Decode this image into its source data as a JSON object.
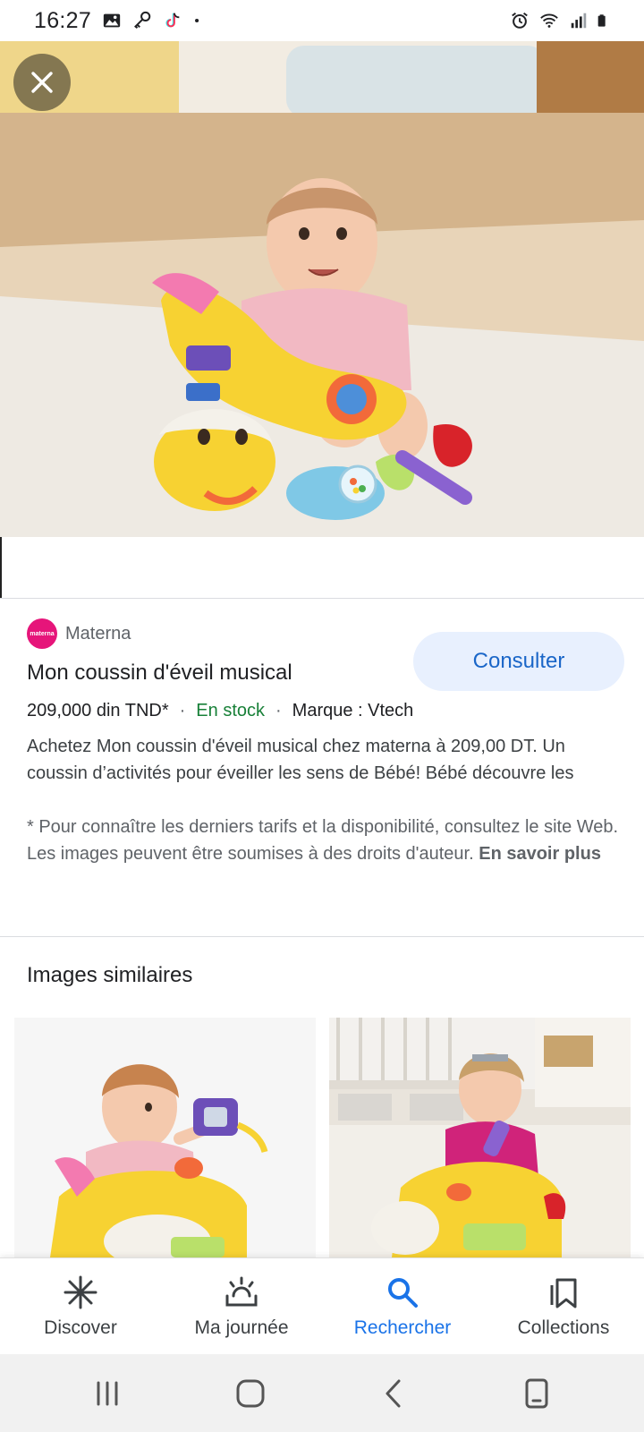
{
  "status_bar": {
    "time": "16:27",
    "left_icons": [
      "gallery-icon",
      "key-icon",
      "tiktok-icon",
      "dot-icon"
    ],
    "right_icons": [
      "alarm-icon",
      "wifi-icon",
      "signal-icon",
      "battery-icon"
    ]
  },
  "hero": {
    "close_icon": "close-icon"
  },
  "product": {
    "source_logo_text": "materna",
    "source_name": "Materna",
    "title": "Mon coussin d'éveil musical",
    "price": "209,000 din TND*",
    "separator": "·",
    "stock": "En stock",
    "brand": "Marque : Vtech",
    "consult_label": "Consulter",
    "description": "Achetez Mon coussin d'éveil musical chez materna à 209,00 DT. Un coussin d’activités pour éveiller les sens de Bébé! Bébé découvre les",
    "disclaimer": "* Pour connaître les derniers tarifs et la disponibilité, consultez le site Web. Les images peuvent être soumises à des droits d'auteur.",
    "learn_more": "En savoir plus"
  },
  "similar": {
    "title": "Images similaires"
  },
  "bottom_nav": {
    "items": [
      {
        "label": "Discover",
        "icon": "asterisk-icon"
      },
      {
        "label": "Ma journée",
        "icon": "sunrise-icon"
      },
      {
        "label": "Rechercher",
        "icon": "search-icon"
      },
      {
        "label": "Collections",
        "icon": "bookmarks-icon"
      }
    ],
    "active_color": "#1a73e8"
  },
  "colors": {
    "accent": "#1a73e8",
    "stock_green": "#188038",
    "brand_pink": "#e6157a",
    "button_bg": "#e8f0fe"
  }
}
